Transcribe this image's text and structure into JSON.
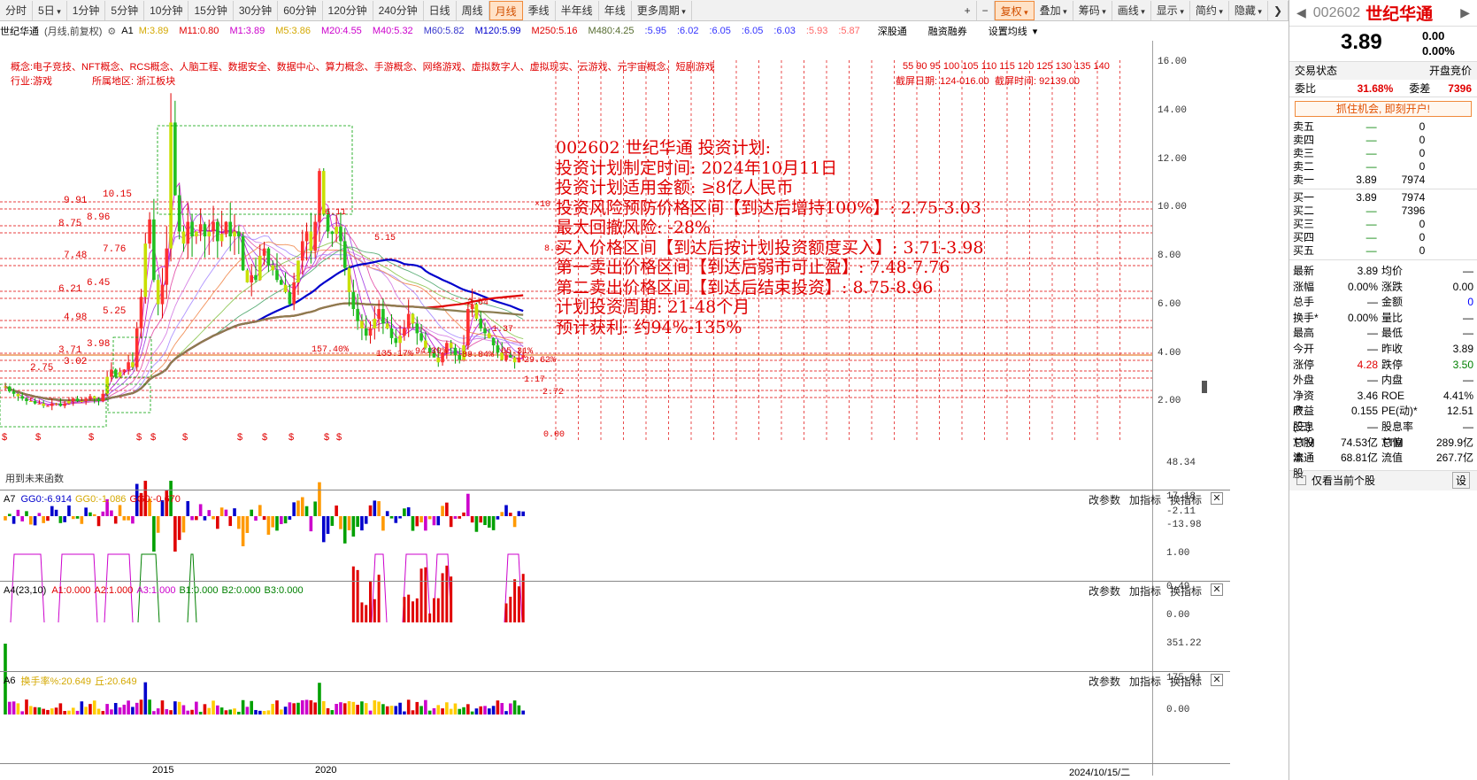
{
  "toolbar": {
    "periods": [
      "分时",
      "5日",
      "1分钟",
      "5分钟",
      "10分钟",
      "15分钟",
      "30分钟",
      "60分钟",
      "120分钟",
      "240分钟",
      "日线",
      "周线",
      "月线",
      "季线",
      "半年线",
      "年线",
      "更多周期"
    ],
    "active_period": "月线",
    "right": [
      "复权",
      "叠加",
      "筹码",
      "画线",
      "显示",
      "简约",
      "隐藏"
    ],
    "plus": "+",
    "minus": "−"
  },
  "info": {
    "name": "世纪华通",
    "mode": "(月线,前复权)",
    "a1": "A1",
    "ma_items": [
      {
        "t": "M:3.89",
        "c": "#d4a800"
      },
      {
        "t": "M11:0.80",
        "c": "#e00000"
      },
      {
        "t": "M1:3.89",
        "c": "#cc00cc"
      },
      {
        "t": "M5:3.86",
        "c": "#d4a800"
      },
      {
        "t": "M20:4.55",
        "c": "#cc00cc"
      },
      {
        "t": "M40:5.32",
        "c": "#cc00cc"
      },
      {
        "t": "M60:5.82",
        "c": "#3333cc"
      },
      {
        "t": "M120:5.99",
        "c": "#0000cc"
      },
      {
        "t": "M250:5.16",
        "c": "#e00000"
      },
      {
        "t": "M480:4.25",
        "c": "#556b2f"
      },
      {
        "t": ":5.95",
        "c": "#3333ff"
      },
      {
        "t": ":6.02",
        "c": "#3333ff"
      },
      {
        "t": ":6.05",
        "c": "#3333ff"
      },
      {
        "t": ":6.05",
        "c": "#3333ff"
      },
      {
        "t": ":6.03",
        "c": "#3333ff"
      },
      {
        "t": ":5.93",
        "c": "#ff6666"
      },
      {
        "t": ":5.87",
        "c": "#ff6666"
      }
    ],
    "shengutong": "深股通",
    "rzrq": "融资融券",
    "setma": "设置均线"
  },
  "concept": {
    "line1": "概念:电子竞技、NFT概念、RCS概念、人脑工程、数据安全、数据中心、算力概念、手游概念、网络游戏、虚拟数字人、虚拟现实、云游戏、元宇宙概念、短剧游戏",
    "industry": "行业:游戏",
    "region": "所属地区: 浙江板块",
    "date_label": "截屏日期: 124-016.00",
    "time_label": "截屏时间: 92139.00",
    "scale_nums": "55  90  95  100 105 110 115 120 125 130 135 140",
    "future_label": "用到未来函数"
  },
  "plan": {
    "lines": [
      "002602 世纪华通 投资计划:",
      "投资计划制定时间: 2024年10月11日",
      "投资计划适用金额: ≥8亿人民币",
      "投资风险预防价格区间【到达后增持100%】: 2.75-3.03",
      "最大回撤风险: -28%",
      "买入价格区间【到达后按计划投资额度买入】: 3.71-3.98",
      "第一卖出价格区间【到达后弱市可止盈】: 7.48-7.76",
      "第二卖出价格区间【到达后结束投资】: 8.75-8.96",
      "计划投资周期: 21-48个月",
      "预计获利: 约94%-135%"
    ]
  },
  "price_axis": [
    "16.00",
    "14.00",
    "12.00",
    "10.00",
    "8.00",
    "6.00",
    "4.00",
    "2.00"
  ],
  "levels": [
    {
      "a": "9.91",
      "b": "10.15"
    },
    {
      "a": "8.75",
      "b": "8.96"
    },
    {
      "a": "7.48",
      "b": "7.76"
    },
    {
      "a": "6.21",
      "b": "6.45"
    },
    {
      "a": "4.98",
      "b": "5.25"
    },
    {
      "a": "3.71",
      "b": "3.98"
    },
    {
      "a": "2.75",
      "b": "3.02"
    }
  ],
  "pct_labels": [
    "157.40%",
    "135.17%",
    "94.39%",
    "89.84%",
    "65.31%",
    "29.62%"
  ],
  "misc_labels": {
    "p1": "6.11",
    "p2": "5.15",
    "p3": "1.17",
    "p4": "2.72",
    "p5": "0.00",
    "p6": "1.37",
    "p7": "2.64",
    "p8": "8.3",
    "p9": "×10"
  },
  "panel_a7": {
    "title": "A7",
    "items": [
      {
        "t": "GG0:-6.914",
        "c": "#0000cc"
      },
      {
        "t": "GG0:-1.086",
        "c": "#d4a800"
      },
      {
        "t": "GG0:-0.670",
        "c": "#e00000"
      }
    ],
    "axis": [
      "48.34",
      "17.18",
      "-2.11",
      "-13.98"
    ]
  },
  "panel_a4": {
    "title": "A4(23,10)",
    "items": [
      {
        "t": "A1:0.000",
        "c": "#e00000"
      },
      {
        "t": "A2:1.000",
        "c": "#e00000"
      },
      {
        "t": "A3:1.000",
        "c": "#cc00cc"
      },
      {
        "t": "B1:0.000",
        "c": "#008000"
      },
      {
        "t": "B2:0.000",
        "c": "#008000"
      },
      {
        "t": "B3:0.000",
        "c": "#008000"
      }
    ],
    "axis": [
      "1.00",
      "0.49",
      "0.00"
    ]
  },
  "panel_a6": {
    "title": "A6",
    "items": [
      {
        "t": "换手率%:20.649",
        "c": "#d4a800"
      },
      {
        "t": "丘:20.649",
        "c": "#d4a800"
      }
    ],
    "axis": [
      "351.22",
      "175.61",
      "0.00"
    ]
  },
  "panel_buttons": [
    "改参数",
    "加指标",
    "换指标"
  ],
  "x_axis": {
    "y2015": "2015",
    "y2020": "2020",
    "date": "2024/10/15/二"
  },
  "quote": {
    "code": "002602",
    "name": "世纪华通",
    "price": "3.89",
    "chg": "0.00",
    "pct": "0.00%",
    "trade_state_label": "交易状态",
    "trade_state_value": "开盘竞价",
    "weibi_label": "委比",
    "weibi_value": "31.68%",
    "weicha_label": "委差",
    "weicha_value": "7396",
    "banner": "抓住机会, 即刻开户!",
    "sells": [
      {
        "l": "卖五",
        "p": "—",
        "v": "0"
      },
      {
        "l": "卖四",
        "p": "—",
        "v": "0"
      },
      {
        "l": "卖三",
        "p": "—",
        "v": "0"
      },
      {
        "l": "卖二",
        "p": "—",
        "v": "0"
      },
      {
        "l": "卖一",
        "p": "3.89",
        "v": "7974"
      }
    ],
    "buys": [
      {
        "l": "买一",
        "p": "3.89",
        "v": "7974"
      },
      {
        "l": "买二",
        "p": "—",
        "v": "7396"
      },
      {
        "l": "买三",
        "p": "—",
        "v": "0"
      },
      {
        "l": "买四",
        "p": "—",
        "v": "0"
      },
      {
        "l": "买五",
        "p": "—",
        "v": "0"
      }
    ],
    "stats": [
      {
        "l1": "最新",
        "v1": "3.89",
        "l2": "均价",
        "v2": "—",
        "c1": "#000",
        "c2": "#000"
      },
      {
        "l1": "涨幅",
        "v1": "0.00%",
        "l2": "涨跌",
        "v2": "0.00",
        "c1": "#000",
        "c2": "#000"
      },
      {
        "l1": "总手",
        "v1": "—",
        "l2": "金额",
        "v2": "0",
        "c1": "#000",
        "c2": "#0000ff"
      },
      {
        "l1": "换手*",
        "v1": "0.00%",
        "l2": "量比",
        "v2": "—",
        "c1": "#000",
        "c2": "#000"
      },
      {
        "l1": "最高",
        "v1": "—",
        "l2": "最低",
        "v2": "—",
        "c1": "#000",
        "c2": "#000"
      },
      {
        "l1": "今开",
        "v1": "—",
        "l2": "昨收",
        "v2": "3.89",
        "c1": "#000",
        "c2": "#000"
      },
      {
        "l1": "涨停",
        "v1": "4.28",
        "l2": "跌停",
        "v2": "3.50",
        "c1": "#e00000",
        "c2": "#008000"
      },
      {
        "l1": "外盘",
        "v1": "—",
        "l2": "内盘",
        "v2": "—",
        "c1": "#000",
        "c2": "#000"
      },
      {
        "l1": "净资产",
        "v1": "3.46",
        "l2": "ROE",
        "v2": "4.41%",
        "c1": "#000",
        "c2": "#000"
      },
      {
        "l1": "收益(三)",
        "v1": "0.155",
        "l2": "PE(动)*",
        "v2": "12.51",
        "c1": "#000",
        "c2": "#000"
      },
      {
        "l1": "股息TTM",
        "v1": "—",
        "l2": "股息率TTM",
        "v2": "—",
        "c1": "#000",
        "c2": "#000"
      },
      {
        "l1": "总股本",
        "v1": "74.53亿",
        "l2": "总值",
        "v2": "289.9亿",
        "c1": "#000",
        "c2": "#000"
      },
      {
        "l1": "流通股",
        "v1": "68.81亿",
        "l2": "流值",
        "v2": "267.7亿",
        "c1": "#000",
        "c2": "#000"
      }
    ],
    "only_current": "仅看当前个股",
    "settings": "设"
  }
}
